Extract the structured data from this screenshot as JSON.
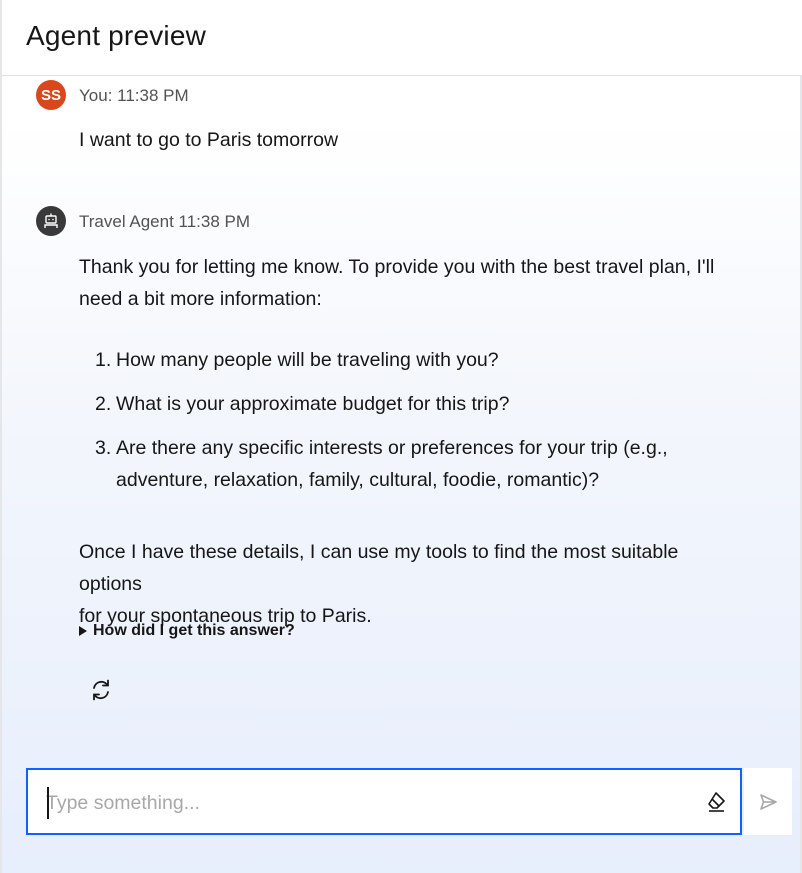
{
  "header": {
    "title": "Agent preview"
  },
  "messages": {
    "user": {
      "initials": "SS",
      "meta": "You: 11:38 PM",
      "text": "I want to go to Paris tomorrow"
    },
    "agent": {
      "meta": "Travel Agent 11:38 PM",
      "intro_line1": "Thank you for letting me know. To provide you with the best travel plan, I'll",
      "intro_line2": "need a bit more information:",
      "questions": [
        {
          "num": "1.",
          "text": "How many people will be traveling with you?"
        },
        {
          "num": "2.",
          "text": "What is your approximate budget for this trip?"
        },
        {
          "num": "3.",
          "line1": "Are there any specific interests or preferences for your trip (e.g.,",
          "line2": "adventure, relaxation, family, cultural, foodie, romantic)?"
        }
      ],
      "outro_line1": "Once I have these details, I can use my tools to find the most suitable options",
      "outro_line2": "for your spontaneous trip to Paris.",
      "explain_label": "How did I get this answer?"
    }
  },
  "composer": {
    "placeholder": "Type something...",
    "value": ""
  },
  "icons": {
    "regenerate": "regenerate-icon",
    "eraser": "eraser-icon",
    "send": "send-icon",
    "robot": "robot-icon"
  },
  "colors": {
    "accent": "#0f62fe",
    "user_avatar": "#d9471c",
    "bot_avatar": "#393939"
  }
}
